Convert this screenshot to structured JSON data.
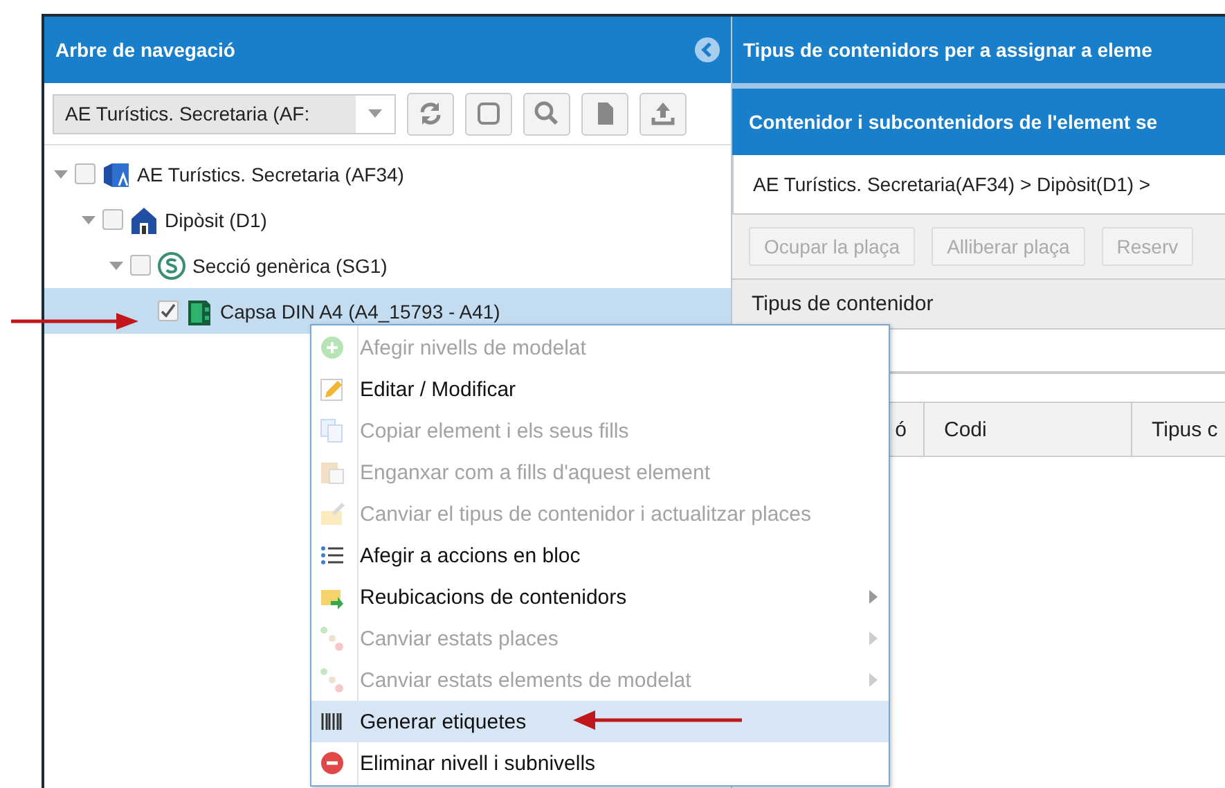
{
  "navigation_panel": {
    "title": "Arbre de navegació",
    "combo": {
      "value": "AE Turístics. Secretaria (AF:"
    },
    "toolbar": [
      {
        "kind": "refresh"
      },
      {
        "kind": "square"
      },
      {
        "kind": "search"
      },
      {
        "kind": "document"
      },
      {
        "kind": "upload"
      }
    ],
    "tree": [
      {
        "label": "AE Turístics. Secretaria (AF34)",
        "kind": "unit",
        "expanded": true,
        "checked": false,
        "selected": false,
        "children": [
          {
            "label": "Dipòsit (D1)",
            "kind": "depot",
            "expanded": true,
            "checked": false,
            "selected": false,
            "children": [
              {
                "label": "Secció genèrica (SG1)",
                "kind": "section",
                "expanded": true,
                "checked": false,
                "selected": false,
                "children": [
                  {
                    "label": "Capsa DIN A4 (A4_15793 - A41)",
                    "kind": "box",
                    "checked": true,
                    "selected": true
                  }
                ]
              }
            ]
          }
        ]
      }
    ]
  },
  "content_panel": {
    "title": "Tipus de contenidors per a assignar a eleme",
    "subpanel": {
      "title": "Contenidor i subcontenidors de l'element se",
      "breadcrumb": "AE Turístics. Secretaria(AF34) > Dipòsit(D1) >",
      "buttons": [
        {
          "label": "Ocupar la plaça",
          "disabled": true
        },
        {
          "label": "Alliberar plaça",
          "disabled": true
        },
        {
          "label": "Reserv",
          "disabled": true
        }
      ],
      "section_title": "Tipus de contenidor",
      "columns": [
        "ó",
        "Codi",
        "Tipus c"
      ]
    }
  },
  "context_menu": {
    "items": [
      {
        "label": "Afegir nivells de modelat",
        "kind": "add",
        "disabled": true,
        "submenu": false,
        "selected": false
      },
      {
        "label": "Editar / Modificar",
        "kind": "edit",
        "disabled": false,
        "submenu": false,
        "selected": false
      },
      {
        "label": "Copiar element i els seus fills",
        "kind": "copy",
        "disabled": true,
        "submenu": false,
        "selected": false
      },
      {
        "label": "Enganxar com a fills d'aquest element",
        "kind": "paste",
        "disabled": true,
        "submenu": false,
        "selected": false
      },
      {
        "label": "Canviar el tipus de contenidor i actualitzar places",
        "kind": "change",
        "disabled": true,
        "submenu": false,
        "selected": false
      },
      {
        "label": "Afegir a accions en bloc",
        "kind": "list",
        "disabled": false,
        "submenu": false,
        "selected": false
      },
      {
        "label": "Reubicacions de contenidors",
        "kind": "move",
        "disabled": false,
        "submenu": true,
        "selected": false
      },
      {
        "label": "Canviar estats places",
        "kind": "states",
        "disabled": true,
        "submenu": true,
        "selected": false
      },
      {
        "label": "Canviar estats elements de modelat",
        "kind": "states",
        "disabled": true,
        "submenu": true,
        "selected": false
      },
      {
        "label": "Generar etiquetes",
        "kind": "barcode",
        "disabled": false,
        "submenu": false,
        "selected": true
      },
      {
        "label": "Eliminar nivell i subnivells",
        "kind": "delete",
        "disabled": false,
        "submenu": false,
        "selected": false
      }
    ]
  }
}
